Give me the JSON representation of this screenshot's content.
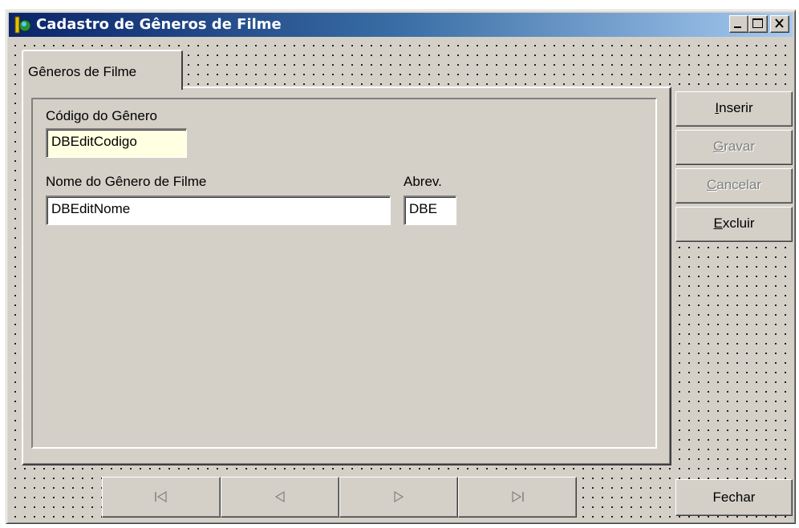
{
  "window": {
    "title": "Cadastro de Gêneros de Filme",
    "icons": [
      "app-icon",
      "minimize-icon",
      "maximize-icon",
      "close-icon"
    ]
  },
  "tab": {
    "label": "Gêneros de Filme"
  },
  "form": {
    "codigo_label": "Código do Gênero",
    "codigo_value": "DBEditCodigo",
    "nome_label": "Nome do Gênero de Filme",
    "nome_value": "DBEditNome",
    "abrev_label": "Abrev.",
    "abrev_value": "DBE"
  },
  "buttons": {
    "inserir": {
      "accel": "I",
      "rest": "nserir"
    },
    "gravar": {
      "accel": "G",
      "rest": "ravar"
    },
    "cancelar": {
      "accel": "C",
      "rest": "ancelar"
    },
    "excluir": {
      "accel": "E",
      "rest": "xcluir"
    },
    "fechar": "Fechar"
  },
  "navigator": {
    "icons": [
      "first-record-icon",
      "prior-record-icon",
      "next-record-icon",
      "last-record-icon"
    ]
  },
  "colors": {
    "face": "#d4d0c8",
    "title_start": "#0a246a",
    "title_end": "#a6caf0",
    "code_field_bg": "#ffffe1"
  }
}
